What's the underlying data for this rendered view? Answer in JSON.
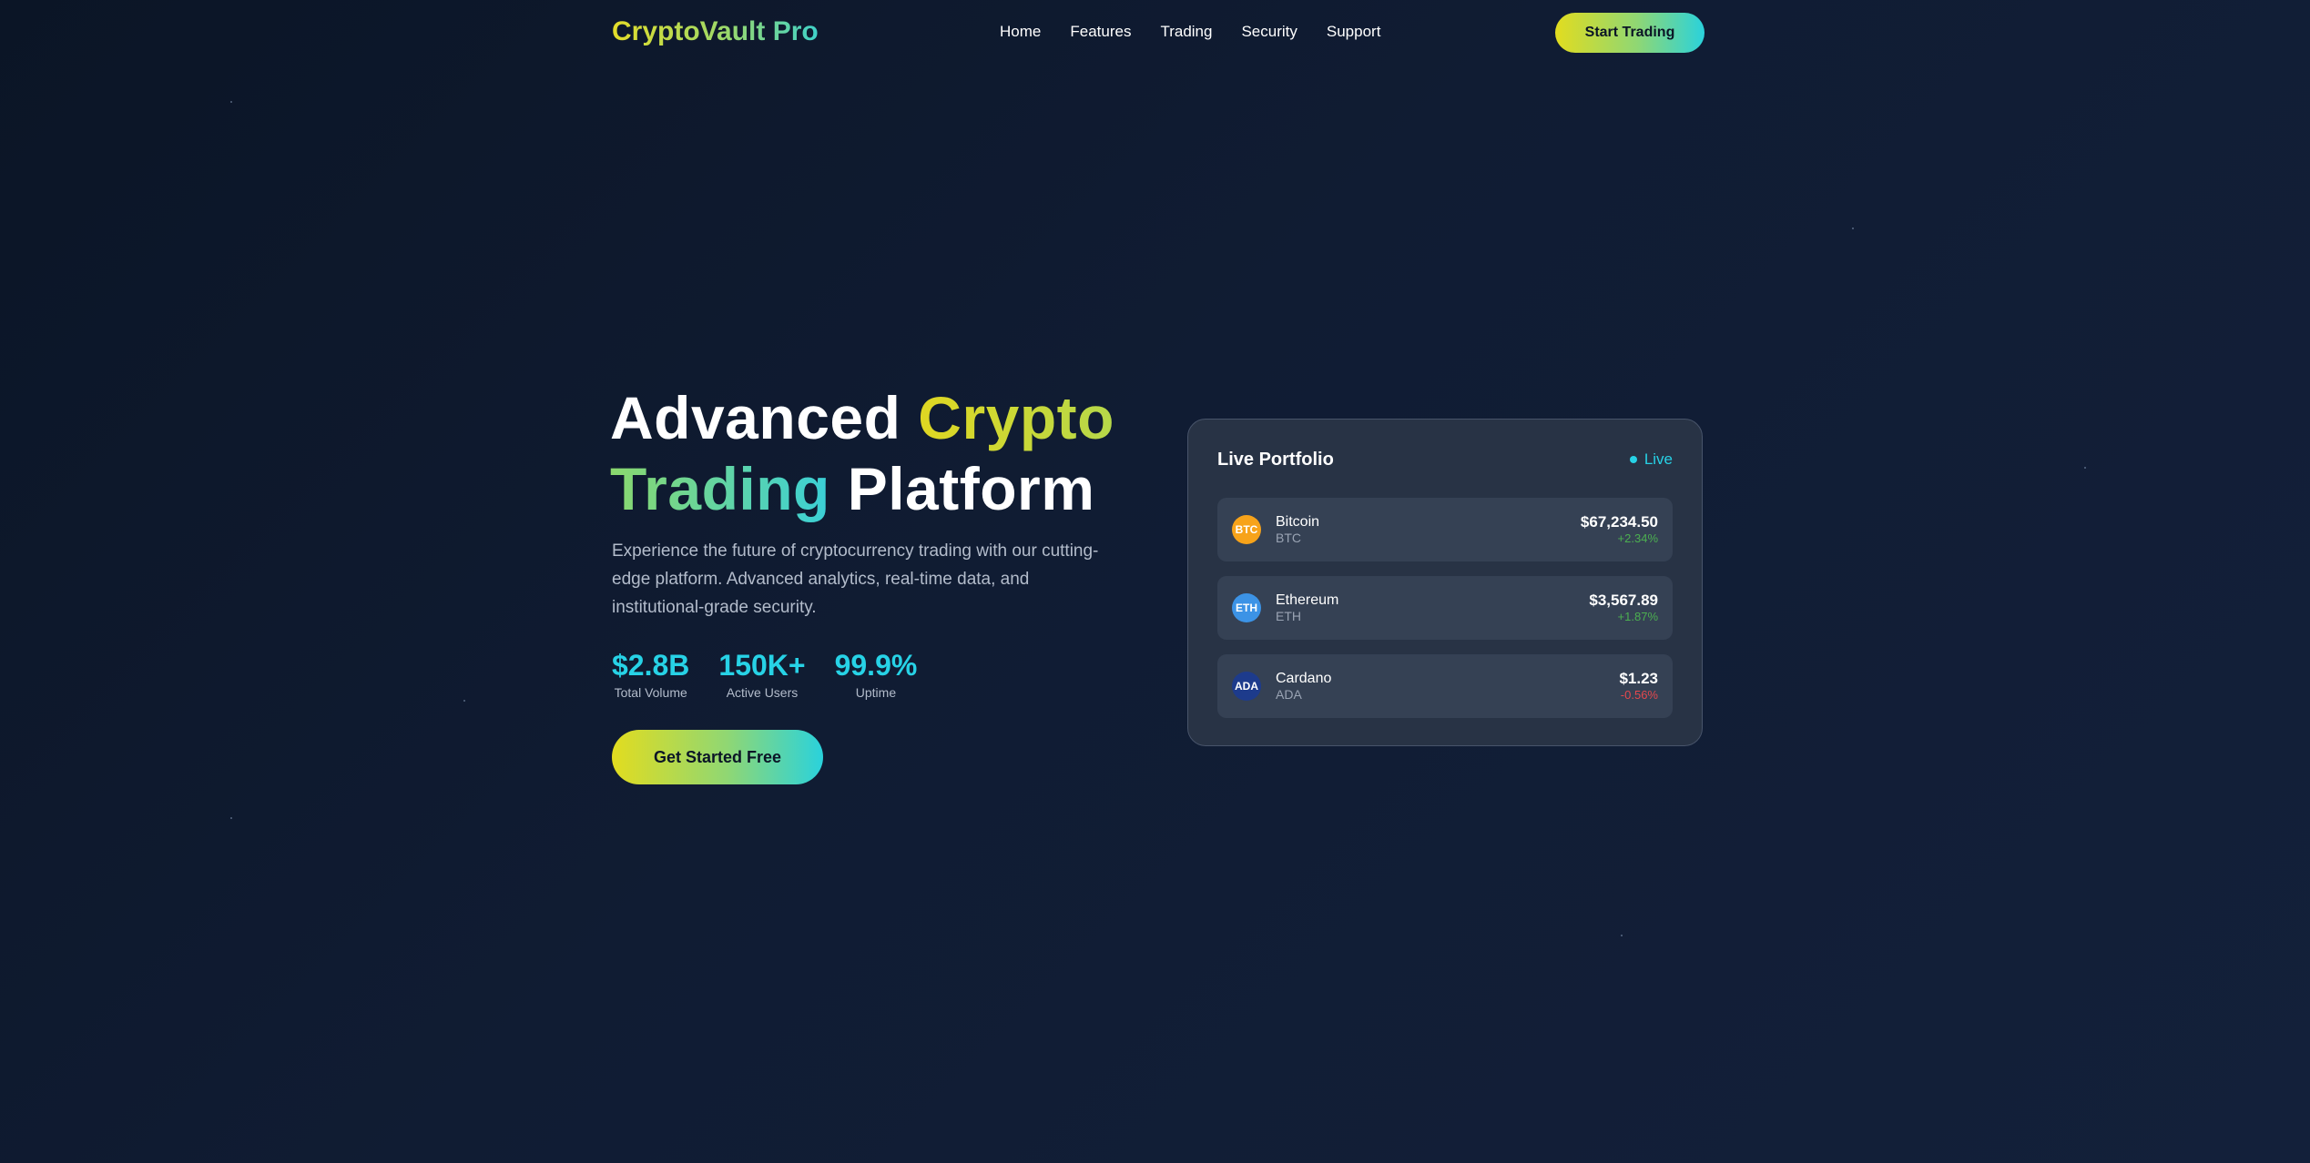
{
  "brand": {
    "name": "CryptoVault Pro"
  },
  "nav": {
    "links": [
      "Home",
      "Features",
      "Trading",
      "Security",
      "Support"
    ],
    "cta_label": "Start Trading"
  },
  "hero": {
    "title_part1": "Advanced ",
    "title_part2": "Crypto",
    "title_part3": "Trading",
    "title_part4": " Platform",
    "description": "Experience the future of cryptocurrency trading with our cutting-edge platform. Advanced analytics, real-time data, and institutional-grade security.",
    "stats": [
      {
        "value": "$2.8B",
        "label": "Total Volume"
      },
      {
        "value": "150K+",
        "label": "Active Users"
      },
      {
        "value": "99.9%",
        "label": "Uptime"
      }
    ],
    "cta_label": "Get Started Free"
  },
  "portfolio": {
    "title": "Live Portfolio",
    "status": "Live",
    "coins": [
      {
        "icon_text": "BTC",
        "name": "Bitcoin",
        "symbol": "BTC",
        "price": "$67,234.50",
        "change": "+2.34%",
        "color": "#f7a31a"
      },
      {
        "icon_text": "ETH",
        "name": "Ethereum",
        "symbol": "ETH",
        "price": "$3,567.89",
        "change": "+1.87%",
        "color": "#3c93e6"
      },
      {
        "icon_text": "ADA",
        "name": "Cardano",
        "symbol": "ADA",
        "price": "$1.23",
        "change": "-0.56%",
        "color": "#1d3b8c"
      }
    ]
  },
  "colors": {
    "positive": "#4caf50",
    "negative": "#e5484d",
    "accent": "#27d2e6"
  }
}
